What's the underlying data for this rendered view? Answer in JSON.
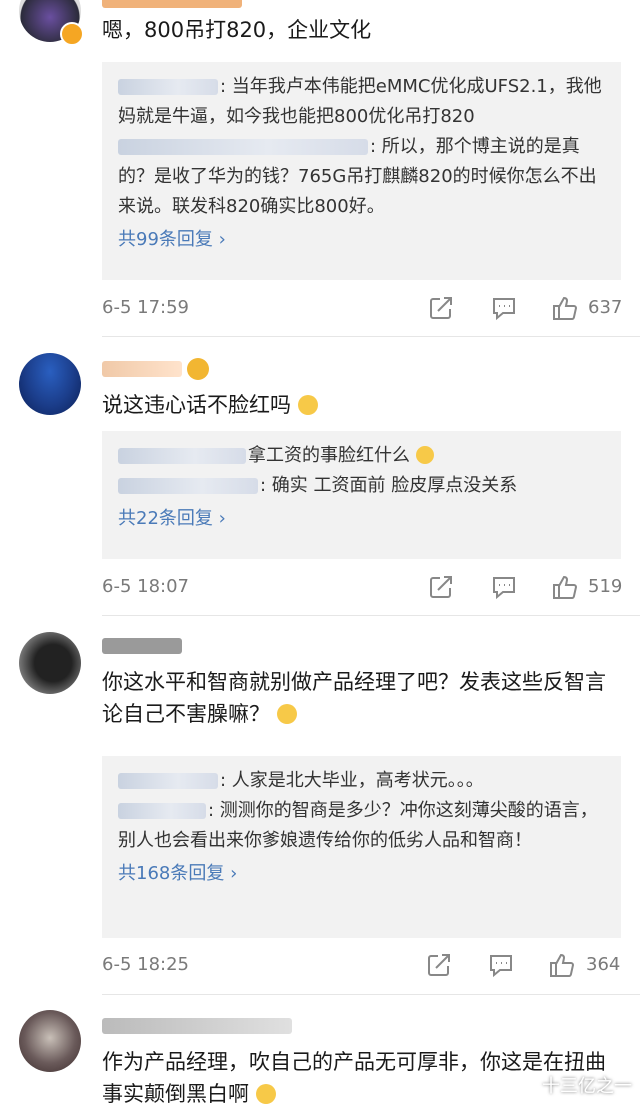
{
  "comments": [
    {
      "username": "",
      "text": "嗯，800吊打820，企业文化",
      "replies": [
        {
          "name": "",
          "text": ": 当年我卢本伟能把eMMC优化成UFS2.1，我他妈就是牛逼，如今我也能把800优化吊打820"
        },
        {
          "name": "",
          "text": ": 所以，那个博主说的是真的？是收了华为的钱？765G吊打麒麟820的时候你怎么不出来说。联发科820确实比800好。"
        }
      ],
      "more": "共99条回复 ›",
      "time": "6-5 17:59",
      "likes": "637"
    },
    {
      "username": "",
      "text": "说这违心话不脸红吗",
      "replies": [
        {
          "name": "",
          "text": "拿工资的事脸红什么"
        },
        {
          "name": "",
          "text": ": 确实 工资面前 脸皮厚点没关系"
        }
      ],
      "more": "共22条回复 ›",
      "time": "6-5 18:07",
      "likes": "519"
    },
    {
      "username": "",
      "text": "你这水平和智商就别做产品经理了吧？发表这些反智言论自己不害臊嘛？",
      "replies": [
        {
          "name": "",
          "text": ": 人家是北大毕业，高考状元。。。"
        },
        {
          "name": "",
          "text": ": 测测你的智商是多少？冲你这刻薄尖酸的语言，别人也会看出来你爹娘遗传给你的低劣人品和智商！"
        }
      ],
      "more": "共168条回复 ›",
      "time": "6-5 18:25",
      "likes": "364"
    },
    {
      "username": "",
      "text": "作为产品经理，吹自己的产品无可厚非，你这是在扭曲事实颠倒黑白啊"
    }
  ],
  "watermark": "十三亿之一",
  "icons": {
    "share": "share-icon",
    "comment": "comment-icon",
    "like": "thumbs-up-icon"
  },
  "colors": {
    "link": "#4a7ab8",
    "reply_bg": "#f2f2f2",
    "meta": "#7a7a7a"
  }
}
